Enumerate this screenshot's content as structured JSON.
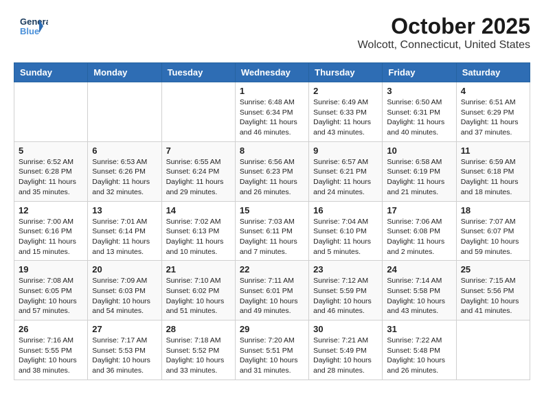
{
  "logo": {
    "line1": "General",
    "line2": "Blue"
  },
  "title": "October 2025",
  "location": "Wolcott, Connecticut, United States",
  "days_of_week": [
    "Sunday",
    "Monday",
    "Tuesday",
    "Wednesday",
    "Thursday",
    "Friday",
    "Saturday"
  ],
  "weeks": [
    [
      {
        "day": "",
        "info": ""
      },
      {
        "day": "",
        "info": ""
      },
      {
        "day": "",
        "info": ""
      },
      {
        "day": "1",
        "info": "Sunrise: 6:48 AM\nSunset: 6:34 PM\nDaylight: 11 hours\nand 46 minutes."
      },
      {
        "day": "2",
        "info": "Sunrise: 6:49 AM\nSunset: 6:33 PM\nDaylight: 11 hours\nand 43 minutes."
      },
      {
        "day": "3",
        "info": "Sunrise: 6:50 AM\nSunset: 6:31 PM\nDaylight: 11 hours\nand 40 minutes."
      },
      {
        "day": "4",
        "info": "Sunrise: 6:51 AM\nSunset: 6:29 PM\nDaylight: 11 hours\nand 37 minutes."
      }
    ],
    [
      {
        "day": "5",
        "info": "Sunrise: 6:52 AM\nSunset: 6:28 PM\nDaylight: 11 hours\nand 35 minutes."
      },
      {
        "day": "6",
        "info": "Sunrise: 6:53 AM\nSunset: 6:26 PM\nDaylight: 11 hours\nand 32 minutes."
      },
      {
        "day": "7",
        "info": "Sunrise: 6:55 AM\nSunset: 6:24 PM\nDaylight: 11 hours\nand 29 minutes."
      },
      {
        "day": "8",
        "info": "Sunrise: 6:56 AM\nSunset: 6:23 PM\nDaylight: 11 hours\nand 26 minutes."
      },
      {
        "day": "9",
        "info": "Sunrise: 6:57 AM\nSunset: 6:21 PM\nDaylight: 11 hours\nand 24 minutes."
      },
      {
        "day": "10",
        "info": "Sunrise: 6:58 AM\nSunset: 6:19 PM\nDaylight: 11 hours\nand 21 minutes."
      },
      {
        "day": "11",
        "info": "Sunrise: 6:59 AM\nSunset: 6:18 PM\nDaylight: 11 hours\nand 18 minutes."
      }
    ],
    [
      {
        "day": "12",
        "info": "Sunrise: 7:00 AM\nSunset: 6:16 PM\nDaylight: 11 hours\nand 15 minutes."
      },
      {
        "day": "13",
        "info": "Sunrise: 7:01 AM\nSunset: 6:14 PM\nDaylight: 11 hours\nand 13 minutes."
      },
      {
        "day": "14",
        "info": "Sunrise: 7:02 AM\nSunset: 6:13 PM\nDaylight: 11 hours\nand 10 minutes."
      },
      {
        "day": "15",
        "info": "Sunrise: 7:03 AM\nSunset: 6:11 PM\nDaylight: 11 hours\nand 7 minutes."
      },
      {
        "day": "16",
        "info": "Sunrise: 7:04 AM\nSunset: 6:10 PM\nDaylight: 11 hours\nand 5 minutes."
      },
      {
        "day": "17",
        "info": "Sunrise: 7:06 AM\nSunset: 6:08 PM\nDaylight: 11 hours\nand 2 minutes."
      },
      {
        "day": "18",
        "info": "Sunrise: 7:07 AM\nSunset: 6:07 PM\nDaylight: 10 hours\nand 59 minutes."
      }
    ],
    [
      {
        "day": "19",
        "info": "Sunrise: 7:08 AM\nSunset: 6:05 PM\nDaylight: 10 hours\nand 57 minutes."
      },
      {
        "day": "20",
        "info": "Sunrise: 7:09 AM\nSunset: 6:03 PM\nDaylight: 10 hours\nand 54 minutes."
      },
      {
        "day": "21",
        "info": "Sunrise: 7:10 AM\nSunset: 6:02 PM\nDaylight: 10 hours\nand 51 minutes."
      },
      {
        "day": "22",
        "info": "Sunrise: 7:11 AM\nSunset: 6:01 PM\nDaylight: 10 hours\nand 49 minutes."
      },
      {
        "day": "23",
        "info": "Sunrise: 7:12 AM\nSunset: 5:59 PM\nDaylight: 10 hours\nand 46 minutes."
      },
      {
        "day": "24",
        "info": "Sunrise: 7:14 AM\nSunset: 5:58 PM\nDaylight: 10 hours\nand 43 minutes."
      },
      {
        "day": "25",
        "info": "Sunrise: 7:15 AM\nSunset: 5:56 PM\nDaylight: 10 hours\nand 41 minutes."
      }
    ],
    [
      {
        "day": "26",
        "info": "Sunrise: 7:16 AM\nSunset: 5:55 PM\nDaylight: 10 hours\nand 38 minutes."
      },
      {
        "day": "27",
        "info": "Sunrise: 7:17 AM\nSunset: 5:53 PM\nDaylight: 10 hours\nand 36 minutes."
      },
      {
        "day": "28",
        "info": "Sunrise: 7:18 AM\nSunset: 5:52 PM\nDaylight: 10 hours\nand 33 minutes."
      },
      {
        "day": "29",
        "info": "Sunrise: 7:20 AM\nSunset: 5:51 PM\nDaylight: 10 hours\nand 31 minutes."
      },
      {
        "day": "30",
        "info": "Sunrise: 7:21 AM\nSunset: 5:49 PM\nDaylight: 10 hours\nand 28 minutes."
      },
      {
        "day": "31",
        "info": "Sunrise: 7:22 AM\nSunset: 5:48 PM\nDaylight: 10 hours\nand 26 minutes."
      },
      {
        "day": "",
        "info": ""
      }
    ]
  ]
}
